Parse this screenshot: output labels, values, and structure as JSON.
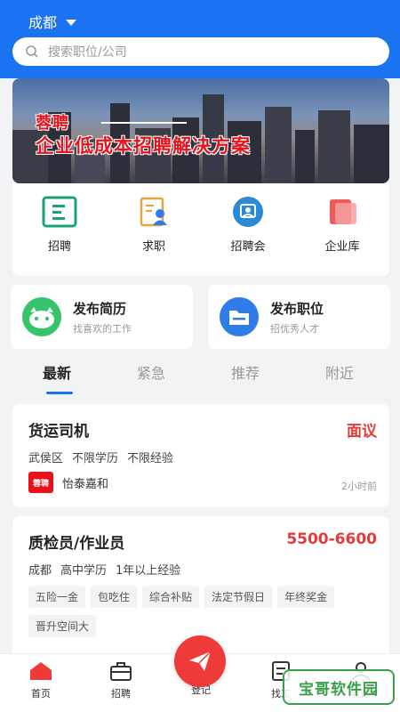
{
  "header": {
    "city": "成都",
    "search_placeholder": "搜索职位/公司"
  },
  "banner": {
    "line1": "蓉聘",
    "line2": "企业低成本招聘解决方案"
  },
  "quick": [
    {
      "label": "招聘",
      "icon": "recruit-icon"
    },
    {
      "label": "求职",
      "icon": "resume-icon"
    },
    {
      "label": "招聘会",
      "icon": "job-fair-icon"
    },
    {
      "label": "企业库",
      "icon": "company-library-icon"
    }
  ],
  "publish": [
    {
      "title": "发布简历",
      "subtitle": "找喜欢的工作"
    },
    {
      "title": "发布职位",
      "subtitle": "招优秀人才"
    }
  ],
  "tabs": [
    "最新",
    "紧急",
    "推荐",
    "附近"
  ],
  "jobs": [
    {
      "title": "货运司机",
      "salary": "面议",
      "meta": [
        "武侯区",
        "不限学历",
        "不限经验"
      ],
      "company": "怡泰嘉和",
      "logo_text": "蓉聘",
      "time": "2小时前"
    },
    {
      "title": "质检员/作业员",
      "salary": "5500-6600",
      "meta": [
        "成都",
        "高中学历",
        "1年以上经验"
      ],
      "tags": [
        "五险一金",
        "包吃住",
        "综合补贴",
        "法定节假日",
        "年终奖金",
        "晋升空间大"
      ]
    }
  ],
  "nav": {
    "home": "首页",
    "recruit": "招聘",
    "register": "登记",
    "jobs": "找工",
    "mine": "我的"
  },
  "watermark": "宝哥软件园",
  "colors": {
    "primary": "#1a73f0",
    "salary": "#e63a3a",
    "send": "#ef3a3a"
  }
}
